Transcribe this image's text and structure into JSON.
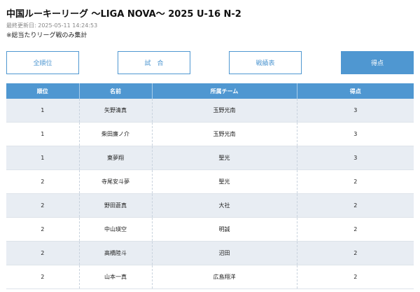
{
  "header": {
    "title": "中国ルーキーリーグ 〜LIGA NOVA〜 2025 U-16 N-2",
    "updated_label": "最終更新日: 2025-05-11 14:24:53",
    "note": "※総当たりリーグ戦のみ集計"
  },
  "tabs": [
    {
      "label": "全順位",
      "active": false
    },
    {
      "label": "試　合",
      "active": false
    },
    {
      "label": "戦績表",
      "active": false
    },
    {
      "label": "得点",
      "active": true
    }
  ],
  "table": {
    "columns": [
      "順位",
      "名前",
      "所属チーム",
      "得点"
    ],
    "rows": [
      {
        "rank": "1",
        "name": "矢野清真",
        "team": "玉野光南",
        "goals": "3"
      },
      {
        "rank": "1",
        "name": "柴田廉ノ介",
        "team": "玉野光南",
        "goals": "3"
      },
      {
        "rank": "1",
        "name": "東夢翔",
        "team": "聖光",
        "goals": "3"
      },
      {
        "rank": "2",
        "name": "寺尾安斗夢",
        "team": "聖光",
        "goals": "2"
      },
      {
        "rank": "2",
        "name": "野田蒼真",
        "team": "大社",
        "goals": "2"
      },
      {
        "rank": "2",
        "name": "中山瑛空",
        "team": "明誠",
        "goals": "2"
      },
      {
        "rank": "2",
        "name": "高橋陸斗",
        "team": "沼田",
        "goals": "2"
      },
      {
        "rank": "2",
        "name": "山本一真",
        "team": "広島翔洋",
        "goals": "2"
      }
    ]
  },
  "colors": {
    "accent": "#4f97d1",
    "row_alt": "#e8edf3"
  }
}
